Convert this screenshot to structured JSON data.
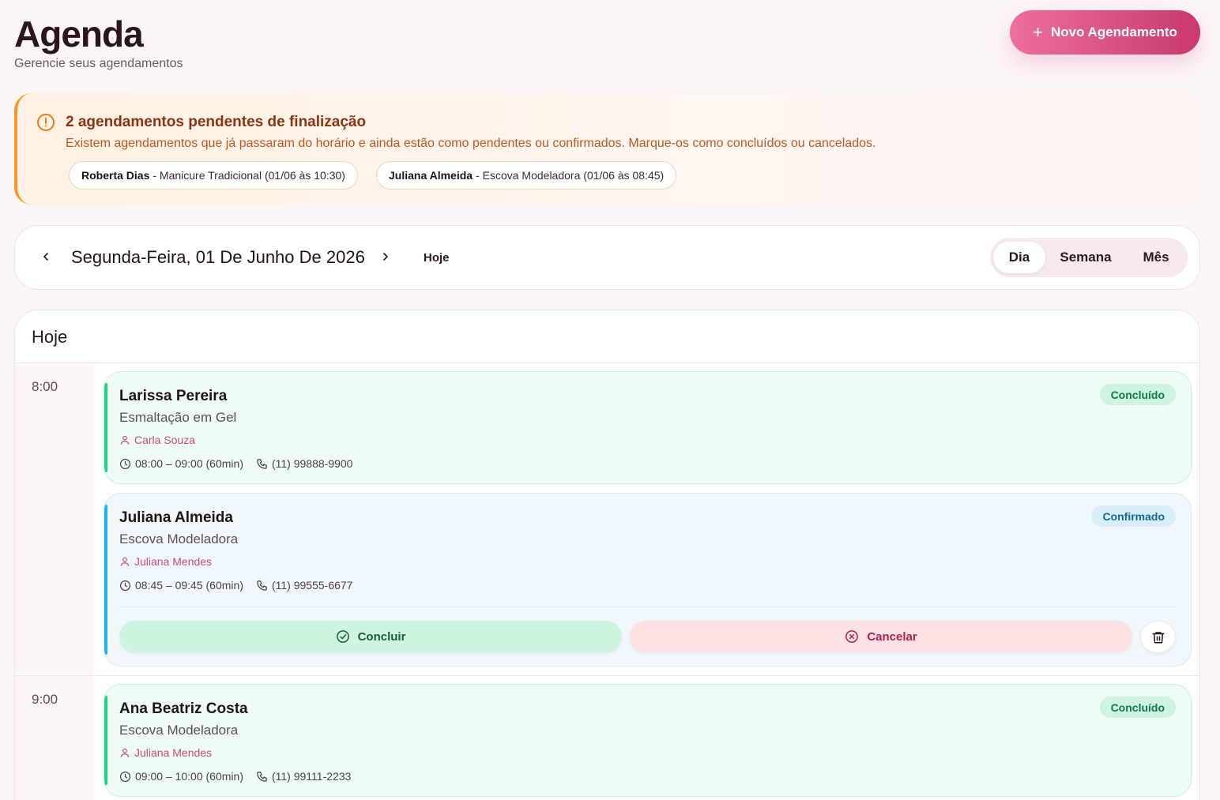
{
  "header": {
    "title": "Agenda",
    "subtitle": "Gerencie seus agendamentos",
    "new_button": "Novo Agendamento"
  },
  "alert": {
    "title": "2 agendamentos pendentes de finalização",
    "description": "Existem agendamentos que já passaram do horário e ainda estão como pendentes ou confirmados. Marque-os como concluídos ou cancelados.",
    "items": [
      {
        "client": "Roberta Dias",
        "details": "- Manicure Tradicional (01/06 às 10:30)"
      },
      {
        "client": "Juliana Almeida",
        "details": "- Escova Modeladora (01/06 às 08:45)"
      }
    ]
  },
  "datebar": {
    "date": "Segunda-Feira, 01 De Junho De 2026",
    "today": "Hoje",
    "views": [
      "Dia",
      "Semana",
      "Mês"
    ],
    "active_view": "Dia"
  },
  "schedule": {
    "title": "Hoje",
    "slots": [
      {
        "time": "8:00",
        "appointments": [
          {
            "client": "Larissa Pereira",
            "service": "Esmaltação em Gel",
            "professional": "Carla Souza",
            "time": "08:00 – 09:00 (60min)",
            "phone": "(11) 99888-9900",
            "status": "Concluído"
          },
          {
            "client": "Juliana Almeida",
            "service": "Escova Modeladora",
            "professional": "Juliana Mendes",
            "time": "08:45 – 09:45 (60min)",
            "phone": "(11) 99555-6677",
            "status": "Confirmado",
            "actions": {
              "complete": "Concluir",
              "cancel": "Cancelar"
            }
          }
        ]
      },
      {
        "time": "9:00",
        "appointments": [
          {
            "client": "Ana Beatriz Costa",
            "service": "Escova Modeladora",
            "professional": "Juliana Mendes",
            "time": "09:00 – 10:00 (60min)",
            "phone": "(11) 99111-2233",
            "status": "Concluído"
          }
        ]
      }
    ]
  },
  "colors": {
    "accent": "#d94a82",
    "done": "#1fcf8a",
    "confirmed": "#1ab4ee",
    "warning": "#f59a2a"
  }
}
